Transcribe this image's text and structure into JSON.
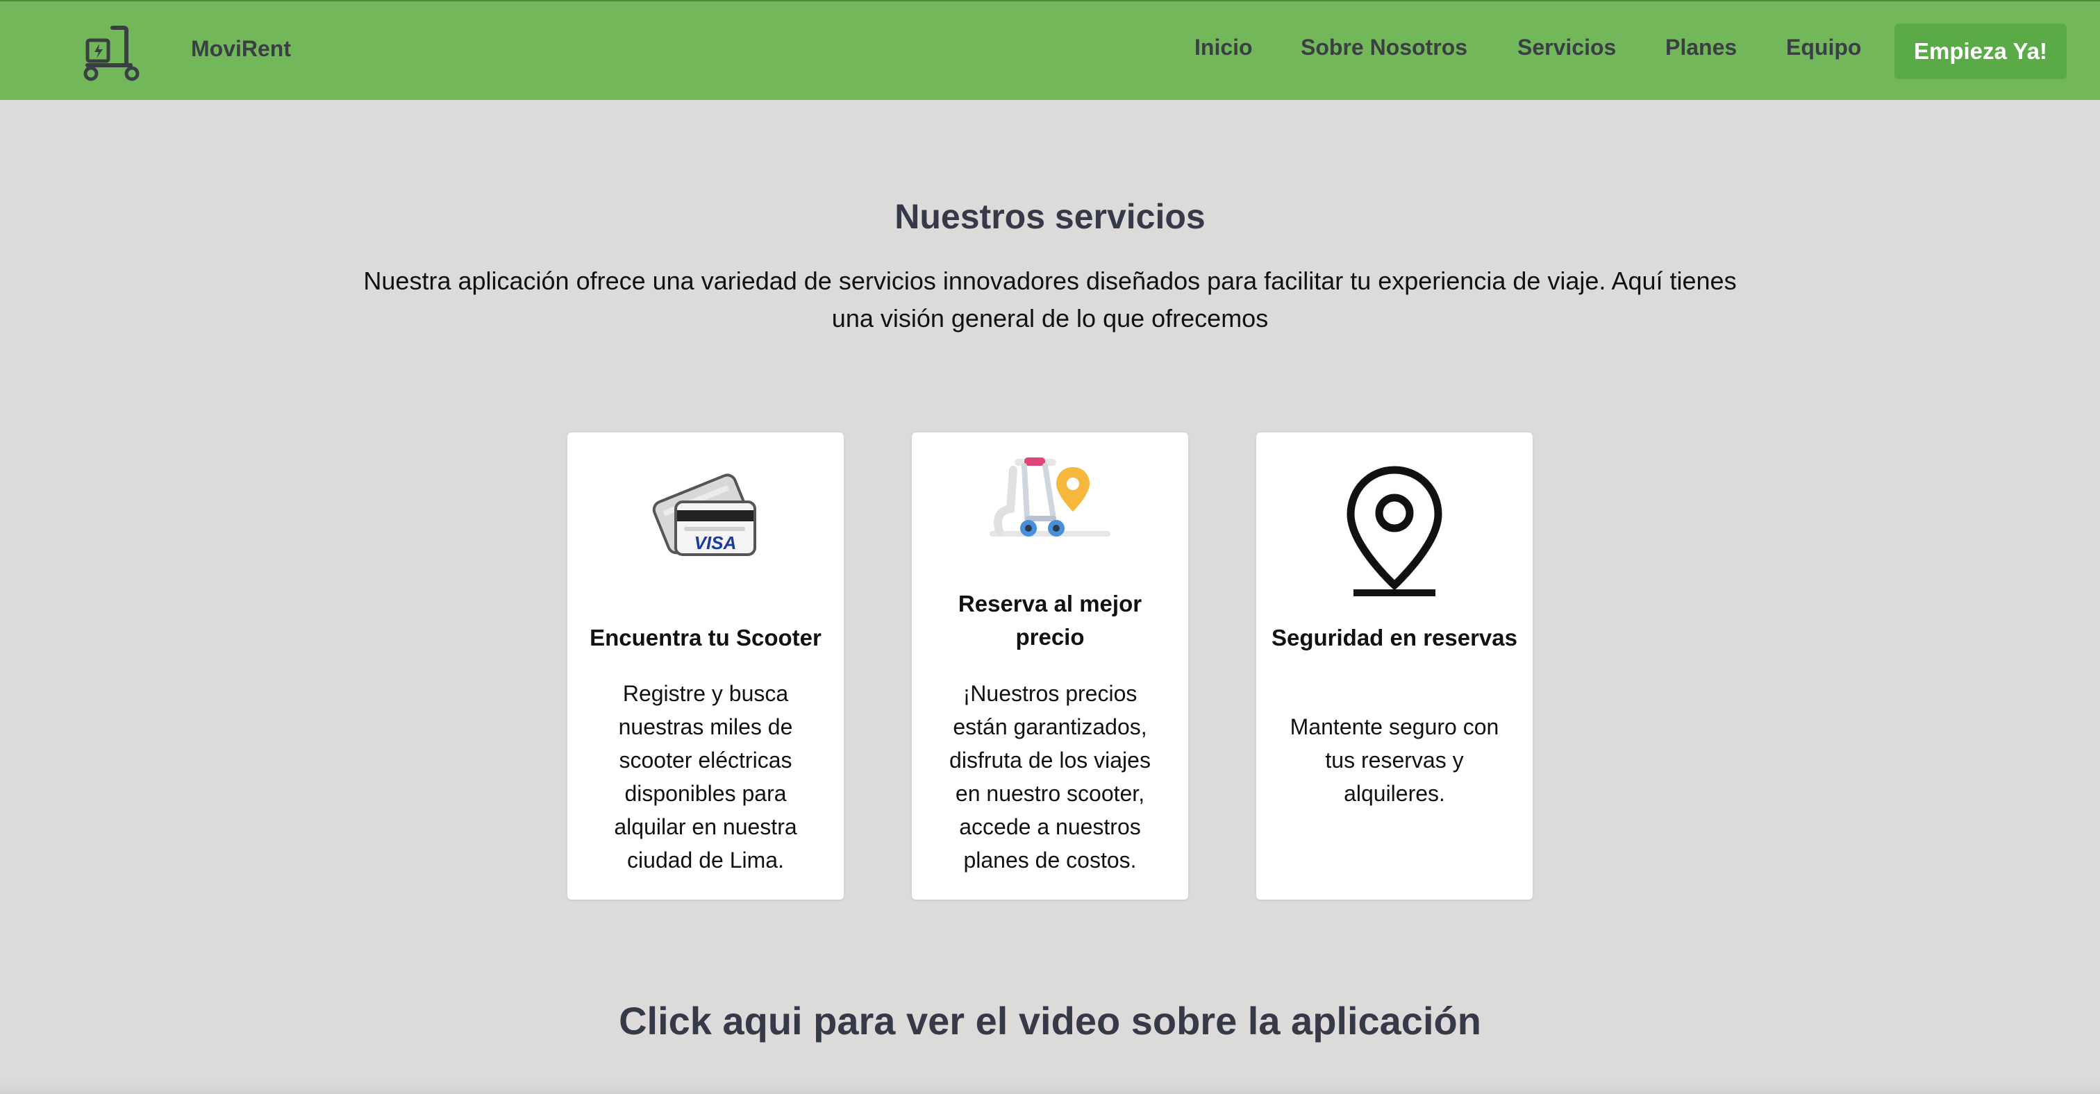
{
  "header": {
    "brand_name": "MoviRent",
    "logo_icon": "electric-scooter-icon",
    "nav": [
      {
        "label": "Inicio"
      },
      {
        "label": "Sobre Nosotros"
      },
      {
        "label": "Servicios"
      },
      {
        "label": "Planes"
      },
      {
        "label": "Equipo"
      }
    ],
    "cta_label": "Empieza Ya!",
    "colors": {
      "background": "#72b85b",
      "cta": "#5aab48",
      "text": "#3a3f44"
    }
  },
  "services": {
    "title": "Nuestros servicios",
    "intro": "Nuestra aplicación ofrece una variedad de servicios innovadores diseñados para facilitar tu experiencia de viaje. Aquí tienes una visión general de lo que ofrecemos",
    "cards": [
      {
        "icon": "credit-card-icon",
        "card_brand": "VISA",
        "title": "Encuentra tu Scooter",
        "text": "Registre y busca nuestras miles de scooter eléctricas disponibles para alquilar en nuestra ciudad de Lima."
      },
      {
        "icon": "scooter-location-icon",
        "title": "Reserva al mejor precio",
        "text": "¡Nuestros precios están garantizados, disfruta de los viajes en nuestro scooter, accede a nuestros planes de costos."
      },
      {
        "icon": "map-pin-icon",
        "title": "Seguridad en reservas",
        "text": "Mantente seguro con tus reservas y alquileres."
      }
    ]
  },
  "video": {
    "title": "Click aqui para ver el video sobre la aplicación"
  },
  "page": {
    "background": "#dcdbda"
  }
}
